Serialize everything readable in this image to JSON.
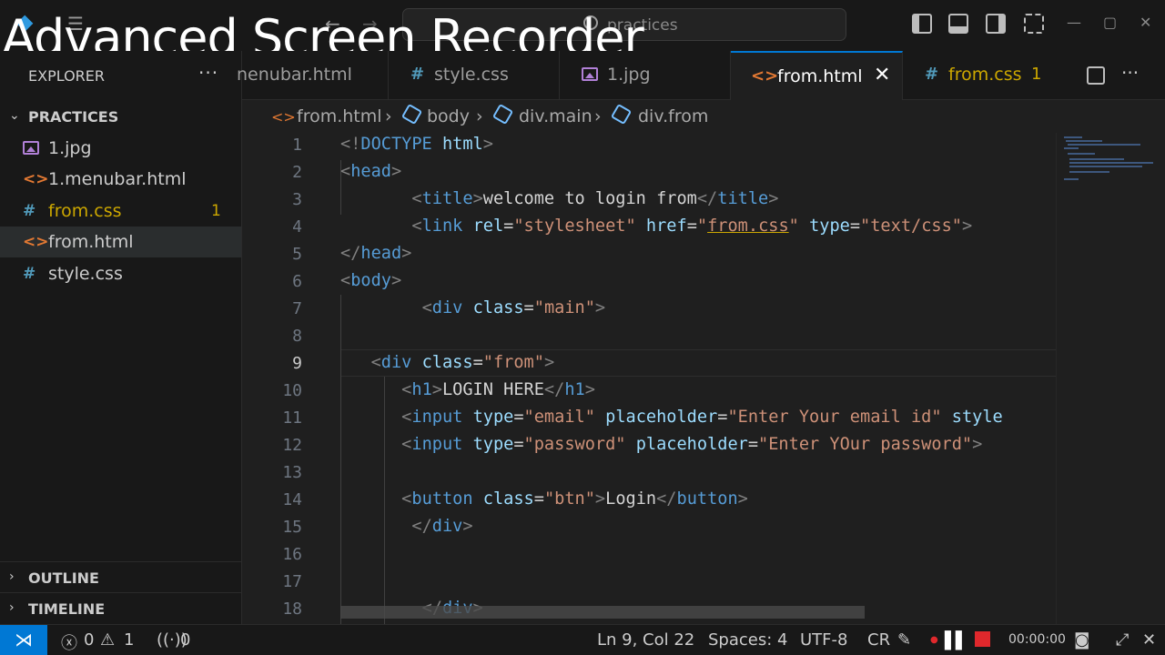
{
  "window": {
    "search_text": "practices",
    "watermark": "Advanced Screen Recorder"
  },
  "sidebar": {
    "title": "EXPLORER",
    "more": "···",
    "folder": "PRACTICES",
    "files": [
      {
        "name": "1.jpg",
        "icon": "image-file-icon"
      },
      {
        "name": "1.menubar.html",
        "icon": "html-file-icon"
      },
      {
        "name": "from.css",
        "icon": "css-file-icon",
        "badge": "1"
      },
      {
        "name": "from.html",
        "icon": "html-file-icon",
        "active": true
      },
      {
        "name": "style.css",
        "icon": "css-file-icon"
      }
    ],
    "outline": "OUTLINE",
    "timeline": "TIMELINE"
  },
  "tabs": [
    {
      "label": "nenubar.html"
    },
    {
      "label": "style.css"
    },
    {
      "label": "1.jpg"
    },
    {
      "label": "from.html",
      "active": true
    },
    {
      "label": "from.css",
      "badge": "1"
    }
  ],
  "breadcrumb": {
    "file": "from.html",
    "parts": [
      "body",
      "div.main",
      "div.from"
    ]
  },
  "editor": {
    "current_line": 9,
    "line_numbers": [
      "1",
      "2",
      "3",
      "4",
      "5",
      "6",
      "7",
      "8",
      "9",
      "10",
      "11",
      "12",
      "13",
      "14",
      "15",
      "16",
      "17",
      "18"
    ]
  },
  "status": {
    "errors": "0",
    "warnings": "1",
    "ports": "0",
    "position": "Ln 9, Col 22",
    "spaces": "Spaces: 4",
    "encoding": "UTF-8",
    "eol": "CR",
    "timer": "00:00:00"
  },
  "colors": {
    "accent": "#0078d4",
    "html_icon": "#e37933",
    "css_icon": "#519aba",
    "image_icon": "#b180d7",
    "warning": "#cca700",
    "record": "#e0282c"
  }
}
